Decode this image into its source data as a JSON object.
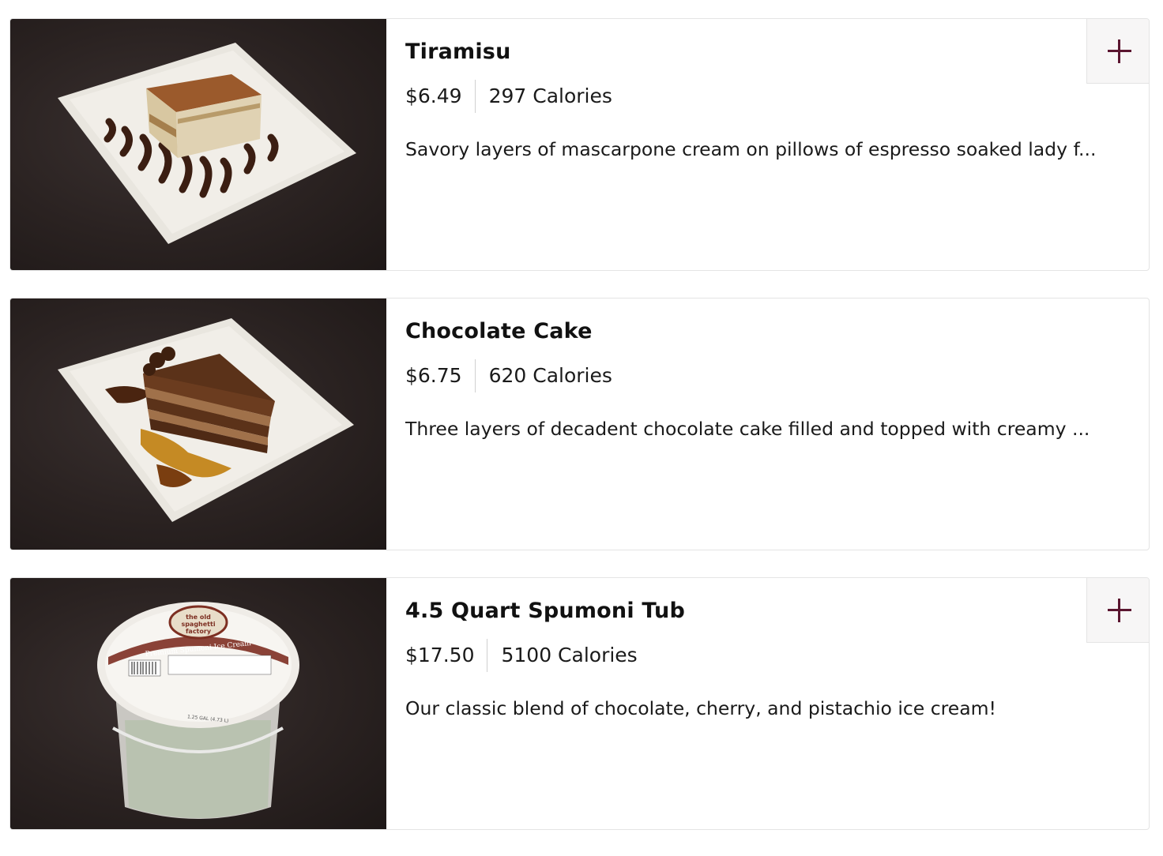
{
  "colors": {
    "accent": "#5b1630",
    "card_border": "#e4e4e4",
    "add_button_bg": "#f7f6f6",
    "text": "#1a1a1a"
  },
  "menu_items": [
    {
      "name": "Tiramisu",
      "price": "$6.49",
      "calories": "297 Calories",
      "description": "Savory layers of mascarpone cream on pillows of espresso soaked lady f...",
      "image_icon": "tiramisu-photo",
      "has_add_button": true
    },
    {
      "name": "Chocolate Cake",
      "price": "$6.75",
      "calories": "620 Calories",
      "description": "Three layers of decadent chocolate cake filled and topped with creamy ...",
      "image_icon": "chocolate-cake-photo",
      "has_add_button": false
    },
    {
      "name": "4.5 Quart Spumoni Tub",
      "price": "$17.50",
      "calories": "5100 Calories",
      "description": "Our classic blend of chocolate, cherry, and pistachio ice cream!",
      "image_icon": "spumoni-tub-photo",
      "has_add_button": true
    }
  ],
  "tub_label": {
    "brand_line1": "the old",
    "brand_line2": "spaghetti",
    "brand_line3": "factory",
    "product_name": "Premium Spumoni Ice Cream",
    "size": "1.25 GAL (4.73 L)"
  }
}
